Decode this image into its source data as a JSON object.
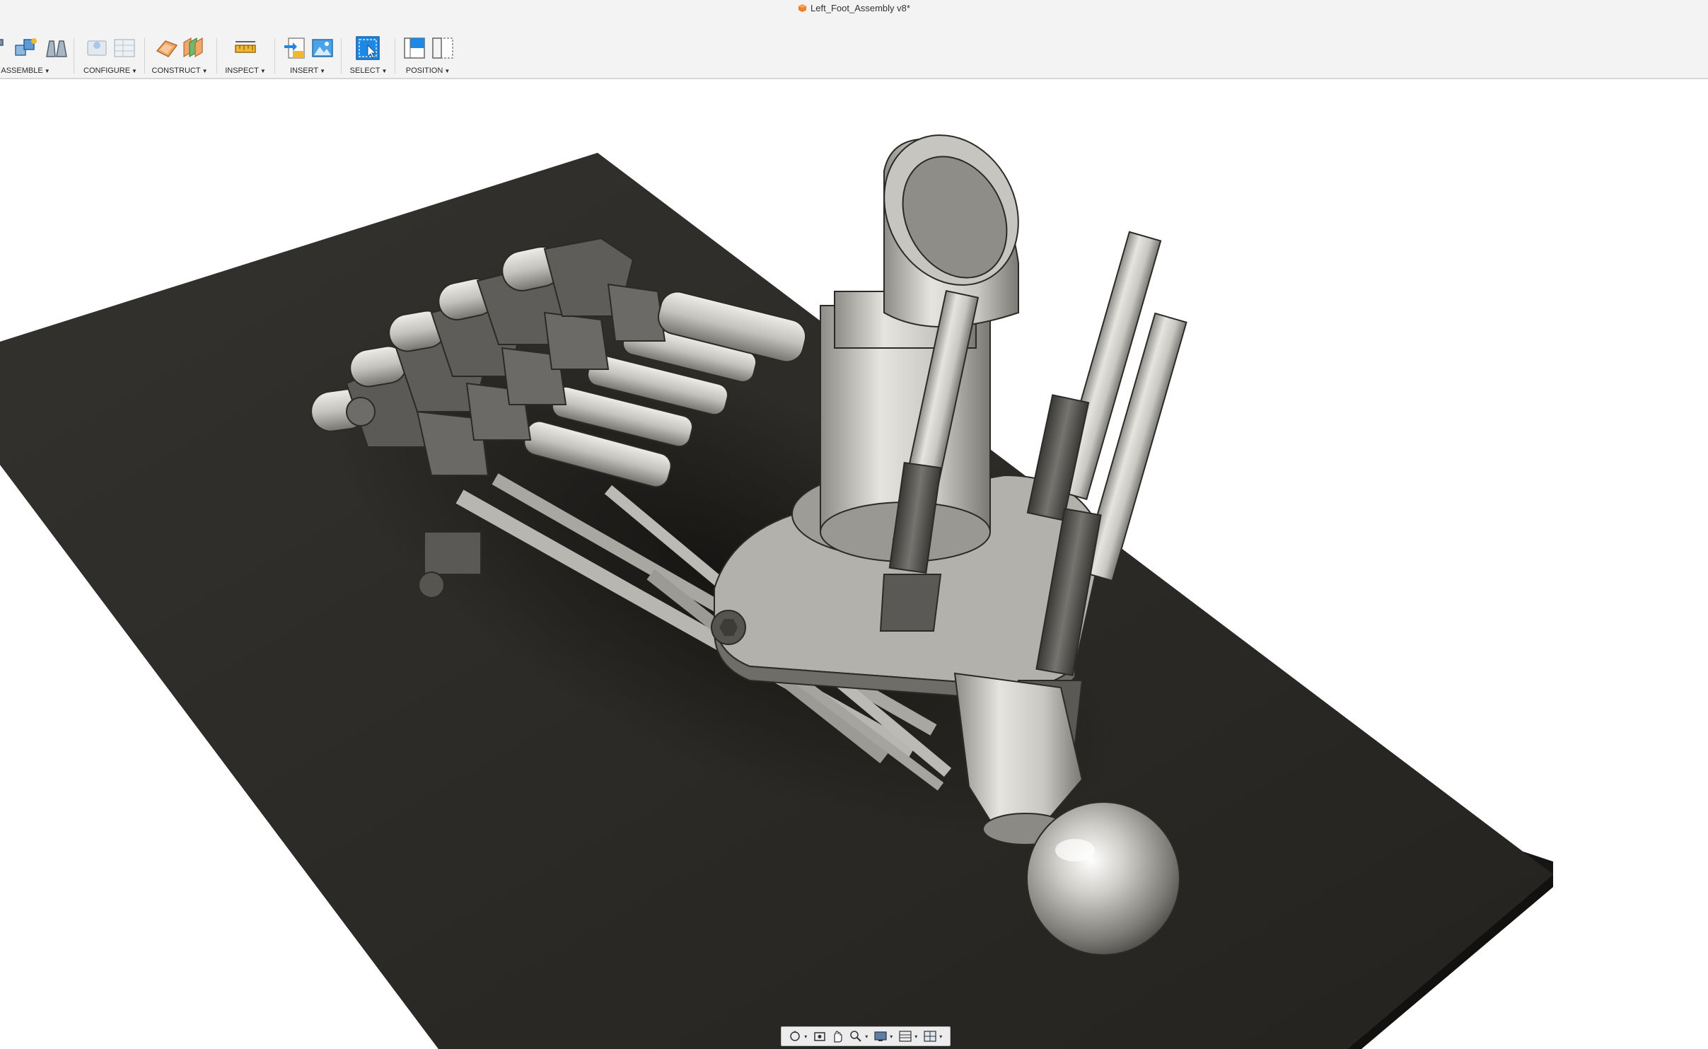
{
  "window": {
    "document_title": "Left_Foot_Assembly v8*"
  },
  "toolbar": {
    "groups": [
      {
        "label": "ASSEMBLE"
      },
      {
        "label": "CONFIGURE"
      },
      {
        "label": "CONSTRUCT"
      },
      {
        "label": "INSPECT"
      },
      {
        "label": "INSERT"
      },
      {
        "label": "SELECT"
      },
      {
        "label": "POSITION"
      }
    ]
  },
  "colors": {
    "accent": "#1e88e5",
    "platform": "#2b2a27",
    "metal_light": "#c9c7c2",
    "metal_dark": "#4a4946",
    "toolbar_bg": "#f3f3f3"
  },
  "navbar": {
    "icons": [
      "orbit-icon",
      "look-at-icon",
      "pan-icon",
      "zoom-icon",
      "display-settings-icon",
      "grid-icon",
      "viewports-icon"
    ]
  }
}
